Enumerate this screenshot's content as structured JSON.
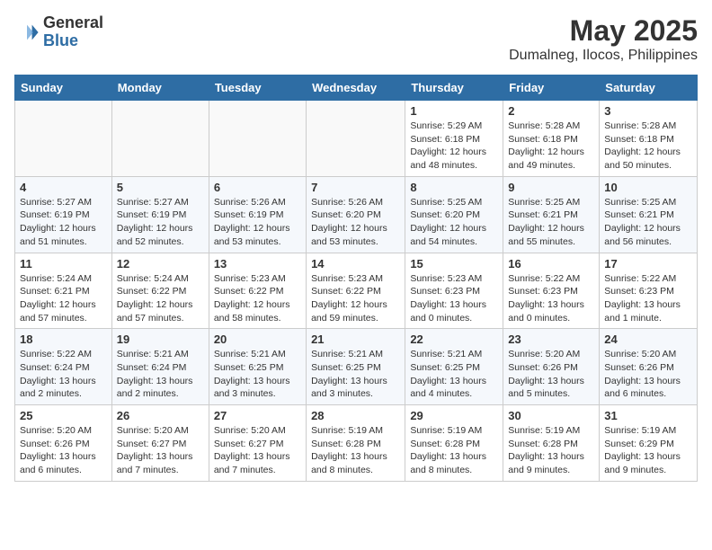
{
  "header": {
    "logo_general": "General",
    "logo_blue": "Blue",
    "month": "May 2025",
    "location": "Dumalneg, Ilocos, Philippines"
  },
  "days_of_week": [
    "Sunday",
    "Monday",
    "Tuesday",
    "Wednesday",
    "Thursday",
    "Friday",
    "Saturday"
  ],
  "weeks": [
    [
      {
        "day": "",
        "info": ""
      },
      {
        "day": "",
        "info": ""
      },
      {
        "day": "",
        "info": ""
      },
      {
        "day": "",
        "info": ""
      },
      {
        "day": "1",
        "info": "Sunrise: 5:29 AM\nSunset: 6:18 PM\nDaylight: 12 hours and 48 minutes."
      },
      {
        "day": "2",
        "info": "Sunrise: 5:28 AM\nSunset: 6:18 PM\nDaylight: 12 hours and 49 minutes."
      },
      {
        "day": "3",
        "info": "Sunrise: 5:28 AM\nSunset: 6:18 PM\nDaylight: 12 hours and 50 minutes."
      }
    ],
    [
      {
        "day": "4",
        "info": "Sunrise: 5:27 AM\nSunset: 6:19 PM\nDaylight: 12 hours and 51 minutes."
      },
      {
        "day": "5",
        "info": "Sunrise: 5:27 AM\nSunset: 6:19 PM\nDaylight: 12 hours and 52 minutes."
      },
      {
        "day": "6",
        "info": "Sunrise: 5:26 AM\nSunset: 6:19 PM\nDaylight: 12 hours and 53 minutes."
      },
      {
        "day": "7",
        "info": "Sunrise: 5:26 AM\nSunset: 6:20 PM\nDaylight: 12 hours and 53 minutes."
      },
      {
        "day": "8",
        "info": "Sunrise: 5:25 AM\nSunset: 6:20 PM\nDaylight: 12 hours and 54 minutes."
      },
      {
        "day": "9",
        "info": "Sunrise: 5:25 AM\nSunset: 6:21 PM\nDaylight: 12 hours and 55 minutes."
      },
      {
        "day": "10",
        "info": "Sunrise: 5:25 AM\nSunset: 6:21 PM\nDaylight: 12 hours and 56 minutes."
      }
    ],
    [
      {
        "day": "11",
        "info": "Sunrise: 5:24 AM\nSunset: 6:21 PM\nDaylight: 12 hours and 57 minutes."
      },
      {
        "day": "12",
        "info": "Sunrise: 5:24 AM\nSunset: 6:22 PM\nDaylight: 12 hours and 57 minutes."
      },
      {
        "day": "13",
        "info": "Sunrise: 5:23 AM\nSunset: 6:22 PM\nDaylight: 12 hours and 58 minutes."
      },
      {
        "day": "14",
        "info": "Sunrise: 5:23 AM\nSunset: 6:22 PM\nDaylight: 12 hours and 59 minutes."
      },
      {
        "day": "15",
        "info": "Sunrise: 5:23 AM\nSunset: 6:23 PM\nDaylight: 13 hours and 0 minutes."
      },
      {
        "day": "16",
        "info": "Sunrise: 5:22 AM\nSunset: 6:23 PM\nDaylight: 13 hours and 0 minutes."
      },
      {
        "day": "17",
        "info": "Sunrise: 5:22 AM\nSunset: 6:23 PM\nDaylight: 13 hours and 1 minute."
      }
    ],
    [
      {
        "day": "18",
        "info": "Sunrise: 5:22 AM\nSunset: 6:24 PM\nDaylight: 13 hours and 2 minutes."
      },
      {
        "day": "19",
        "info": "Sunrise: 5:21 AM\nSunset: 6:24 PM\nDaylight: 13 hours and 2 minutes."
      },
      {
        "day": "20",
        "info": "Sunrise: 5:21 AM\nSunset: 6:25 PM\nDaylight: 13 hours and 3 minutes."
      },
      {
        "day": "21",
        "info": "Sunrise: 5:21 AM\nSunset: 6:25 PM\nDaylight: 13 hours and 3 minutes."
      },
      {
        "day": "22",
        "info": "Sunrise: 5:21 AM\nSunset: 6:25 PM\nDaylight: 13 hours and 4 minutes."
      },
      {
        "day": "23",
        "info": "Sunrise: 5:20 AM\nSunset: 6:26 PM\nDaylight: 13 hours and 5 minutes."
      },
      {
        "day": "24",
        "info": "Sunrise: 5:20 AM\nSunset: 6:26 PM\nDaylight: 13 hours and 6 minutes."
      }
    ],
    [
      {
        "day": "25",
        "info": "Sunrise: 5:20 AM\nSunset: 6:26 PM\nDaylight: 13 hours and 6 minutes."
      },
      {
        "day": "26",
        "info": "Sunrise: 5:20 AM\nSunset: 6:27 PM\nDaylight: 13 hours and 7 minutes."
      },
      {
        "day": "27",
        "info": "Sunrise: 5:20 AM\nSunset: 6:27 PM\nDaylight: 13 hours and 7 minutes."
      },
      {
        "day": "28",
        "info": "Sunrise: 5:19 AM\nSunset: 6:28 PM\nDaylight: 13 hours and 8 minutes."
      },
      {
        "day": "29",
        "info": "Sunrise: 5:19 AM\nSunset: 6:28 PM\nDaylight: 13 hours and 8 minutes."
      },
      {
        "day": "30",
        "info": "Sunrise: 5:19 AM\nSunset: 6:28 PM\nDaylight: 13 hours and 9 minutes."
      },
      {
        "day": "31",
        "info": "Sunrise: 5:19 AM\nSunset: 6:29 PM\nDaylight: 13 hours and 9 minutes."
      }
    ]
  ]
}
